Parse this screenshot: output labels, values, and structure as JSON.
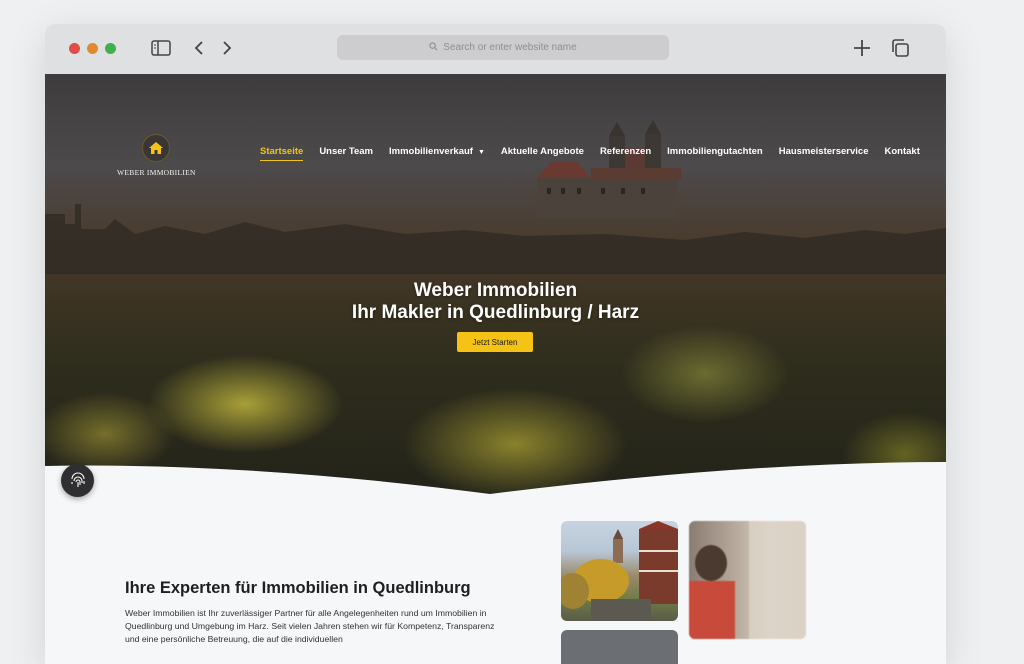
{
  "browser": {
    "url_placeholder": "Search or enter website name",
    "icons": [
      "sidebar-icon",
      "back-icon",
      "forward-icon",
      "search-icon",
      "new-tab-icon",
      "tabs-icon"
    ]
  },
  "site": {
    "logo_text": "WEBER IMMOBILIEN",
    "brand_color": "#f5c315",
    "nav": [
      {
        "label": "Startseite",
        "active": true
      },
      {
        "label": "Unser Team"
      },
      {
        "label": "Immobilienverkauf",
        "dropdown": true
      },
      {
        "label": "Aktuelle Angebote"
      },
      {
        "label": "Referenzen"
      },
      {
        "label": "Immobiliengutachten"
      },
      {
        "label": "Hausmeisterservice"
      },
      {
        "label": "Kontakt"
      }
    ],
    "hero": {
      "title_line1": "Weber Immobilien",
      "title_line2": "Ihr Makler in Quedlinburg / Harz",
      "cta": "Jetzt Starten"
    },
    "section": {
      "title": "Ihre Experten für Immobilien in Quedlinburg",
      "text": "Weber Immobilien ist Ihr zuverlässiger Partner für alle Angelegenheiten rund um Immobilien in Quedlinburg und Umgebung im Harz. Seit vielen Jahren stehen wir für Kompetenz, Transparenz und eine persönliche Betreuung, die auf die individuellen"
    }
  }
}
